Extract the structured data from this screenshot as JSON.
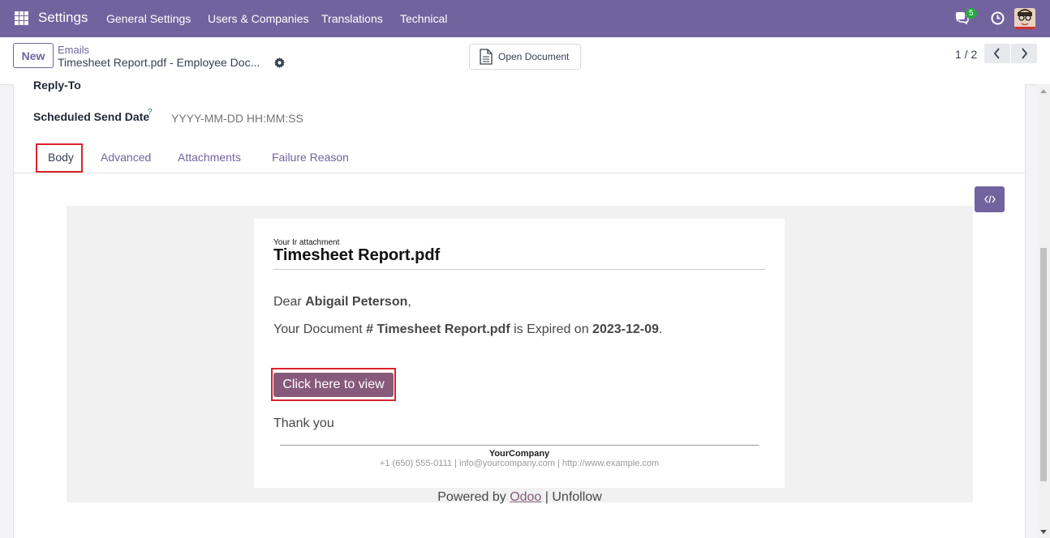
{
  "navbar": {
    "brand": "Settings",
    "menu": [
      "General Settings",
      "Users & Companies",
      "Translations",
      "Technical"
    ],
    "chat_badge": "5",
    "accent": "#71639e"
  },
  "control": {
    "new_label": "New",
    "breadcrumb_parent": "Emails",
    "breadcrumb_current": "Timesheet Report.pdf - Employee Doc...",
    "open_document_label": "Open Document",
    "pager": "1 / 2"
  },
  "form": {
    "reply_to_label": "Reply-To",
    "scheduled_label": "Scheduled Send Date",
    "help_mark": "?",
    "scheduled_placeholder": "YYYY-MM-DD HH:MM:SS"
  },
  "tabs": [
    "Body",
    "Advanced",
    "Attachments",
    "Failure Reason"
  ],
  "email": {
    "kicker": "Your Ir attachment",
    "title": "Timesheet Report.pdf",
    "greeting_prefix": "Dear ",
    "recipient": "Abigail Peterson",
    "greeting_suffix": ",",
    "doc_prefix": "Your Document ",
    "doc_name": "# Timesheet Report.pdf",
    "doc_mid": " is Expired on ",
    "expiry_date": "2023-12-09",
    "doc_suffix": ".",
    "button_label": "Click here to view",
    "thanks": "Thank you",
    "company": "YourCompany",
    "contact": "+1 (650) 555-0111 | info@yourcompany.com | http://www.example.com",
    "powered_prefix": "Powered by ",
    "powered_link": "Odoo",
    "powered_suffix": " | Unfollow",
    "button_color": "#875a7b"
  }
}
